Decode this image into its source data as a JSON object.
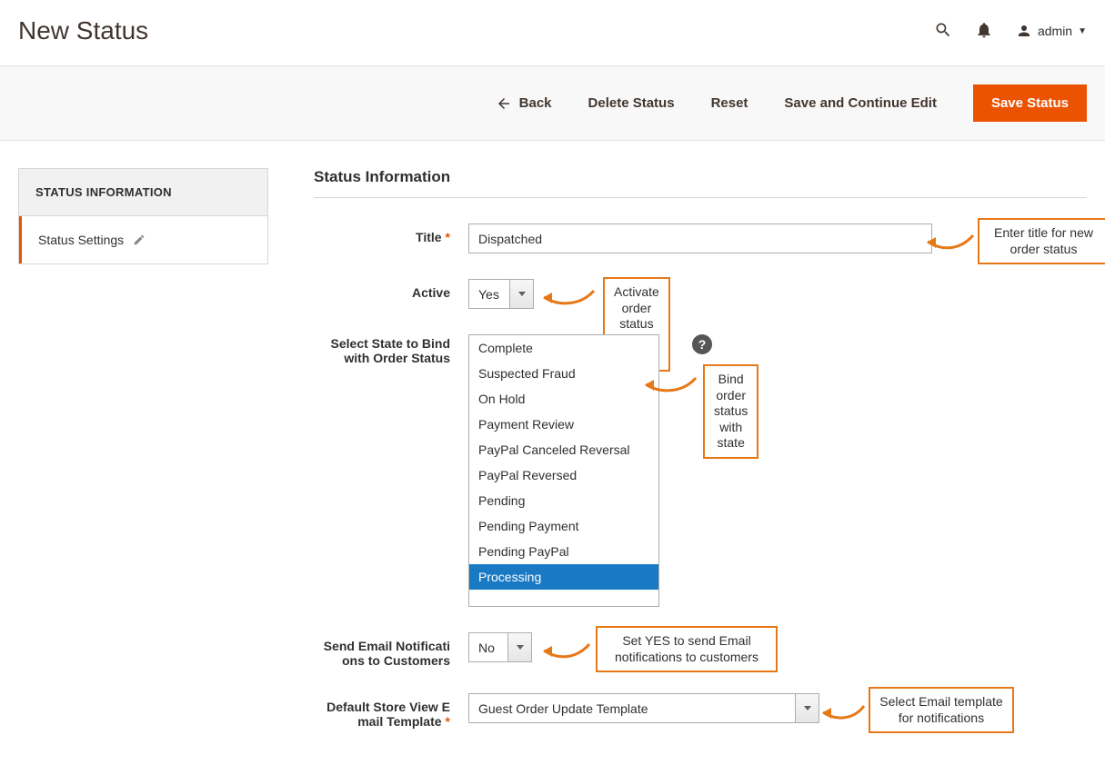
{
  "header": {
    "page_title": "New Status",
    "admin_user": "admin"
  },
  "actions": {
    "back": "Back",
    "delete": "Delete Status",
    "reset": "Reset",
    "save_continue": "Save and Continue Edit",
    "save": "Save Status"
  },
  "sidebar": {
    "panel_title": "STATUS INFORMATION",
    "item_label": "Status Settings"
  },
  "form": {
    "section_title": "Status Information",
    "title_label": "Title",
    "title_value": "Dispatched",
    "active_label": "Active",
    "active_value": "Yes",
    "state_label": "Select State to Bind with Order Status",
    "state_options": [
      "Complete",
      "Suspected Fraud",
      "On Hold",
      "Payment Review",
      "PayPal Canceled Reversal",
      "PayPal Reversed",
      "Pending",
      "Pending Payment",
      "Pending PayPal",
      "Processing"
    ],
    "state_selected_index": 9,
    "notify_label": "Send Email Notificati ons to Customers",
    "notify_value": "No",
    "template_label": "Default Store View E mail Template",
    "template_value": "Guest Order Update Template"
  },
  "annotations": {
    "title": "Enter title for new order status",
    "active": "Activate order status from here",
    "state": "Bind order status with state",
    "notify": "Set YES to send Email notifications to customers",
    "template": "Select Email template for notifications"
  }
}
